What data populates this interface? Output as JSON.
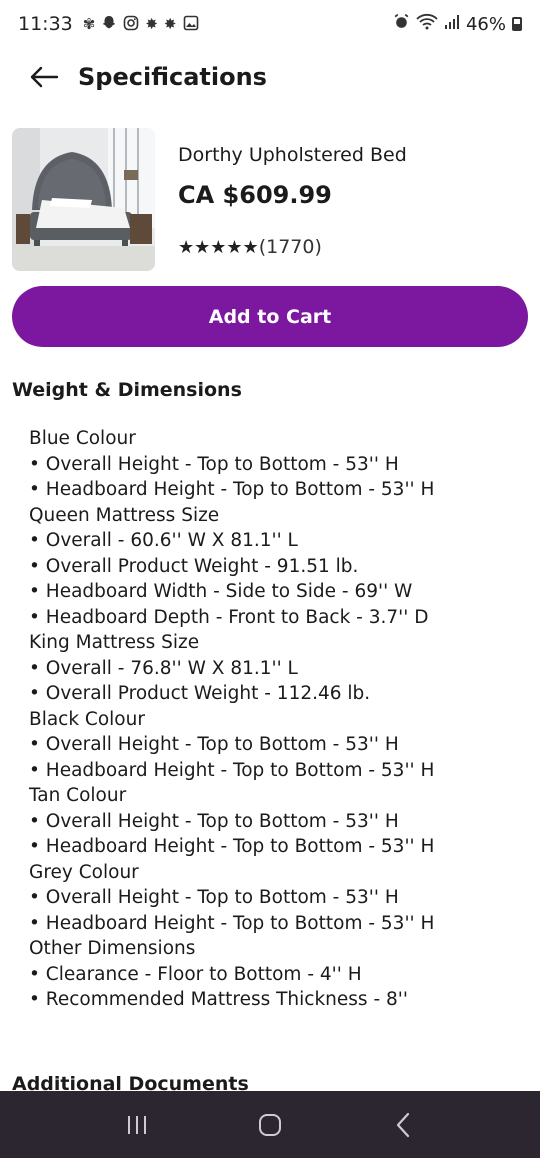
{
  "status_bar": {
    "time": "11:33",
    "battery": "46%",
    "left_icons": [
      "fan-icon",
      "snapchat-icon",
      "instagram-icon",
      "maple-leaf-icon",
      "maple-leaf-icon",
      "gallery-icon"
    ],
    "right_icons": [
      "alarm-icon",
      "wifi-icon",
      "signal-icon",
      "battery-icon"
    ]
  },
  "header": {
    "title": "Specifications",
    "back_icon": "arrow-left-icon"
  },
  "product": {
    "name": "Dorthy Upholstered Bed",
    "price": "CA $609.99",
    "stars": "★★★★★",
    "review_count": "(1770)"
  },
  "actions": {
    "add_to_cart": "Add to Cart"
  },
  "specs": {
    "heading": "Weight & Dimensions",
    "lines": [
      "Blue Colour",
      "• Overall Height - Top to Bottom - 53'' H",
      "• Headboard Height - Top to Bottom - 53'' H",
      "Queen Mattress Size",
      "• Overall - 60.6'' W X 81.1'' L",
      "• Overall Product Weight - 91.51 lb.",
      "• Headboard Width - Side to Side - 69'' W",
      "• Headboard Depth - Front to Back - 3.7'' D",
      "King Mattress Size",
      "• Overall - 76.8'' W X 81.1'' L",
      "• Overall Product Weight - 112.46 lb.",
      "Black Colour",
      "• Overall Height - Top to Bottom - 53'' H",
      "• Headboard Height - Top to Bottom - 53'' H",
      "Tan Colour",
      "• Overall Height - Top to Bottom - 53'' H",
      "• Headboard Height - Top to Bottom - 53'' H",
      "Grey Colour",
      "• Overall Height - Top to Bottom - 53'' H",
      "• Headboard Height - Top to Bottom - 53'' H",
      "Other Dimensions",
      "• Clearance - Floor to Bottom - 4'' H",
      "• Recommended Mattress Thickness - 8''"
    ],
    "next_section": "Additional Documents"
  },
  "nav": {
    "recents_icon": "recents-icon",
    "home_icon": "home-icon",
    "back_icon": "back-chevron-icon"
  },
  "colors": {
    "accent": "#7b189f",
    "nav_bar": "#2c2630"
  }
}
